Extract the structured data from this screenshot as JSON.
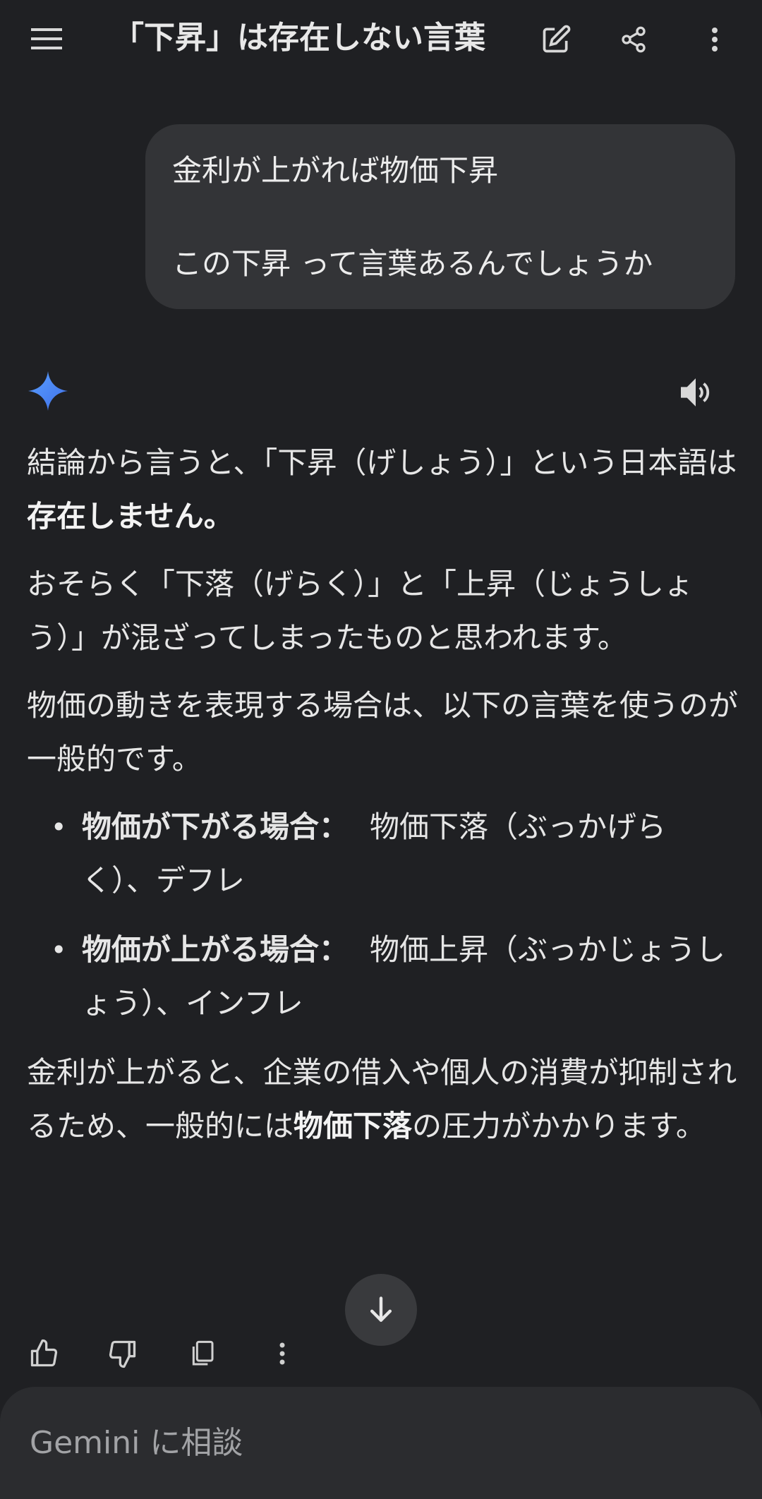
{
  "header": {
    "title": "「下昇」は存在しない言葉"
  },
  "user_message": {
    "line1": "金利が上がれば物価下昇",
    "line2": "この下昇 って言葉あるんでしょうか"
  },
  "response": {
    "p1_a": "結論から言うと、「下昇（げしょう）」という日本語は",
    "p1_bold": "存在しません。",
    "p2": "おそらく「下落（げらく）」と「上昇（じょうしょう）」が混ざってしまったものと思われます。",
    "p3": "物価の動きを表現する場合は、以下の言葉を使うのが一般的です。",
    "bullets": [
      {
        "label": "物価が下がる場合：",
        "text": "物価下落（ぶっかげらく）、デフレ"
      },
      {
        "label": "物価が上がる場合：",
        "text": "物価上昇（ぶっかじょうしょう）、インフレ"
      }
    ],
    "p4_a": "金利が上がると、企業の借入や個人の消費が抑制されるため、一般的には",
    "p4_bold": "物価下落",
    "p4_b": "の圧力がかかります。"
  },
  "composer": {
    "placeholder": "Gemini に相談"
  },
  "colors": {
    "background": "#1f2023",
    "bubble": "#333437",
    "composer": "#2b2c2f",
    "gemini_star": "#4c8df6"
  }
}
